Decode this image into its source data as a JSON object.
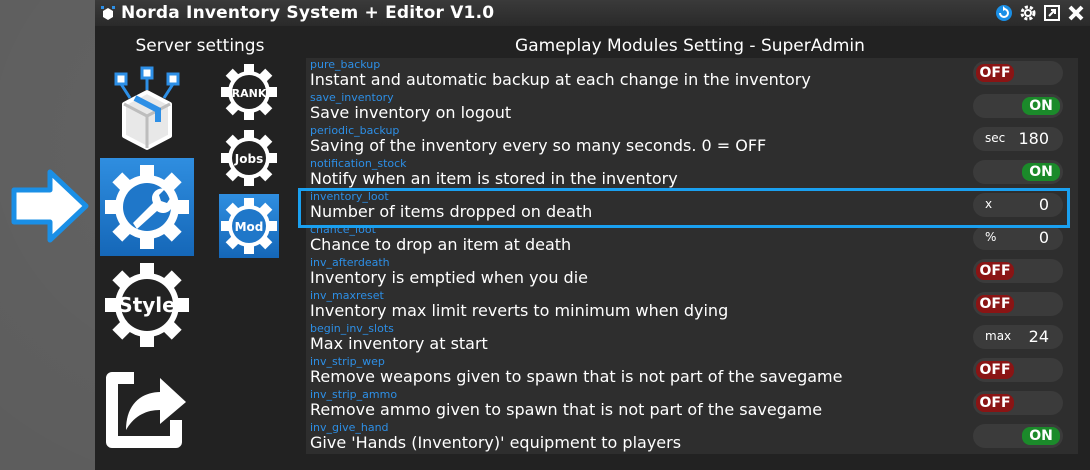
{
  "window": {
    "title": "Norda Inventory System + Editor V1.0",
    "controls": [
      "refresh-icon",
      "gear-icon",
      "expand-icon",
      "close-icon"
    ]
  },
  "sidebar": {
    "title": "Server settings",
    "main_icons": [
      {
        "name": "backup-box-icon",
        "selected": false
      },
      {
        "name": "wrench-gear-icon",
        "selected": true
      },
      {
        "name": "style-gear-icon",
        "label": "Style",
        "selected": false
      },
      {
        "name": "export-icon",
        "selected": false
      }
    ],
    "sub_icons": [
      {
        "name": "rank-gear-icon",
        "label": "RANK",
        "selected": false
      },
      {
        "name": "jobs-gear-icon",
        "label": "Jobs",
        "selected": false
      },
      {
        "name": "mod-gear-icon",
        "label": "Mod",
        "selected": true
      }
    ]
  },
  "main": {
    "title": "Gameplay Modules Setting - SuperAdmin",
    "settings": [
      {
        "key": "pure_backup",
        "label": "Instant and automatic backup at each change in the inventory",
        "type": "toggle",
        "value": "OFF"
      },
      {
        "key": "save_inventory",
        "label": "Save inventory on logout",
        "type": "toggle",
        "value": "ON"
      },
      {
        "key": "periodic_backup",
        "label": "Saving of the inventory every so many seconds. 0 = OFF",
        "type": "number",
        "unit": "sec",
        "value": "180"
      },
      {
        "key": "notification_stock",
        "label": "Notify when an item is stored in the inventory",
        "type": "toggle",
        "value": "ON"
      },
      {
        "key": "inventory_loot",
        "label": "Number of items dropped on death",
        "type": "number",
        "unit": "x",
        "value": "0"
      },
      {
        "key": "chance_loot",
        "label": "Chance to drop an item at death",
        "type": "number",
        "unit": "%",
        "value": "0"
      },
      {
        "key": "inv_afterdeath",
        "label": "Inventory is emptied when you die",
        "type": "toggle",
        "value": "OFF"
      },
      {
        "key": "inv_maxreset",
        "label": "Inventory max limit reverts to minimum when dying",
        "type": "toggle",
        "value": "OFF"
      },
      {
        "key": "begin_inv_slots",
        "label": "Max inventory at start",
        "type": "number",
        "unit": "max",
        "value": "24"
      },
      {
        "key": "inv_strip_wep",
        "label": "Remove weapons given to spawn that is not part of the savegame",
        "type": "toggle",
        "value": "OFF"
      },
      {
        "key": "inv_strip_ammo",
        "label": "Remove ammo given to spawn that is not part of the savegame",
        "type": "toggle",
        "value": "OFF"
      },
      {
        "key": "inv_give_hand",
        "label": "Give 'Hands (Inventory)' equipment to players",
        "type": "toggle",
        "value": "ON"
      }
    ]
  },
  "colors": {
    "accent": "#1aa0f0",
    "on": "#1b8a2a",
    "off": "#8a1414",
    "key_text": "#2d8fe6"
  }
}
